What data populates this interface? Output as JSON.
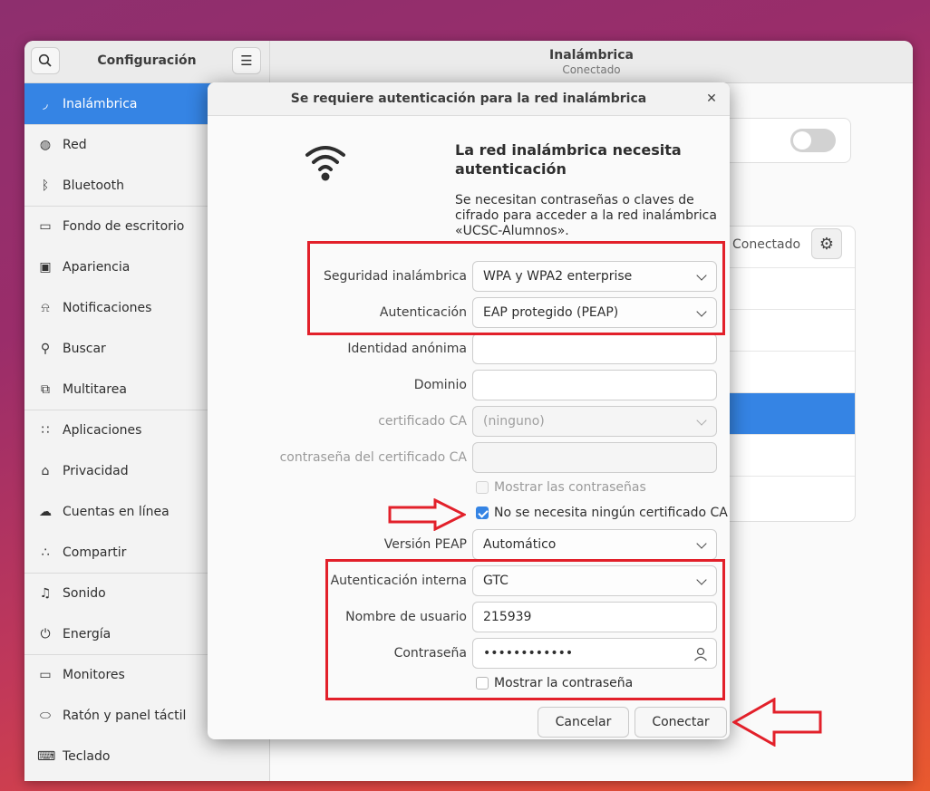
{
  "sidebar": {
    "title": "Configuración",
    "items": [
      {
        "label": "Inalámbrica",
        "icon": "wifi-icon",
        "glyph": "◞"
      },
      {
        "label": "Red",
        "icon": "globe-icon",
        "glyph": "◍"
      },
      {
        "label": "Bluetooth",
        "icon": "bluetooth-icon",
        "glyph": "ᛒ"
      },
      {
        "label": "Fondo de escritorio",
        "icon": "monitor-icon",
        "glyph": "▭"
      },
      {
        "label": "Apariencia",
        "icon": "appearance-icon",
        "glyph": "▣"
      },
      {
        "label": "Notificaciones",
        "icon": "bell-icon",
        "glyph": "⍾"
      },
      {
        "label": "Buscar",
        "icon": "search-icon",
        "glyph": "⚲"
      },
      {
        "label": "Multitarea",
        "icon": "multitask-icon",
        "glyph": "⧉"
      },
      {
        "label": "Aplicaciones",
        "icon": "apps-grid-icon",
        "glyph": "∷"
      },
      {
        "label": "Privacidad",
        "icon": "lock-icon",
        "glyph": "⌂"
      },
      {
        "label": "Cuentas en línea",
        "icon": "cloud-icon",
        "glyph": "☁"
      },
      {
        "label": "Compartir",
        "icon": "share-icon",
        "glyph": "∴"
      },
      {
        "label": "Sonido",
        "icon": "music-note-icon",
        "glyph": "♫"
      },
      {
        "label": "Energía",
        "icon": "power-icon",
        "glyph": "⏻"
      },
      {
        "label": "Monitores",
        "icon": "display-icon",
        "glyph": "▭"
      },
      {
        "label": "Ratón y panel táctil",
        "icon": "mouse-icon",
        "glyph": "⬭"
      },
      {
        "label": "Teclado",
        "icon": "keyboard-icon",
        "glyph": "⌨"
      }
    ]
  },
  "header": {
    "title": "Inalámbrica",
    "subtitle": "Conectado",
    "wifi_enabled": true
  },
  "background": {
    "connected_label": "Conectado"
  },
  "dialog": {
    "title": "Se requiere autenticación para la red inalámbrica",
    "heading": "La red inalámbrica necesita autenticación",
    "description": "Se necesitan contraseñas o claves de cifrado para acceder a la red inalámbrica «UCSC-Alumnos».",
    "fields": {
      "security_label": "Seguridad inalámbrica",
      "security_value": "WPA y WPA2 enterprise",
      "auth_label": "Autenticación",
      "auth_value": "EAP protegido (PEAP)",
      "anon_identity_label": "Identidad anónima",
      "anon_identity_value": "",
      "domain_label": "Dominio",
      "domain_value": "",
      "ca_cert_label": "certificado CA",
      "ca_cert_value": "(ninguno)",
      "ca_cert_password_label": "contraseña del certificado CA",
      "ca_cert_password_value": "",
      "show_passwords_label": "Mostrar las contraseñas",
      "no_ca_needed_label": "No se necesita ningún certificado CA",
      "no_ca_needed_checked": true,
      "peap_version_label": "Versión PEAP",
      "peap_version_value": "Automático",
      "inner_auth_label": "Autenticación interna",
      "inner_auth_value": "GTC",
      "username_label": "Nombre de usuario",
      "username_value": "215939",
      "password_label": "Contraseña",
      "password_value": "••••••••••••",
      "show_password_label": "Mostrar la contraseña"
    },
    "buttons": {
      "cancel": "Cancelar",
      "connect": "Conectar"
    }
  },
  "colors": {
    "accent": "#3584e4",
    "annotation_red": "#e2202a"
  }
}
